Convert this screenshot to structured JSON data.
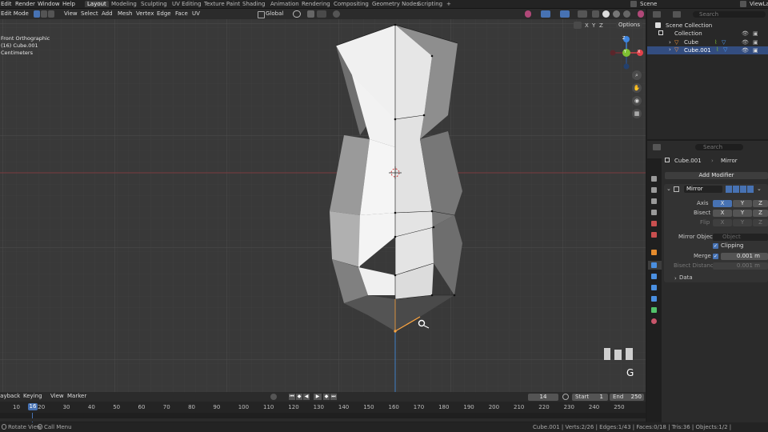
{
  "menus": [
    "Edit",
    "Render",
    "Window",
    "Help"
  ],
  "workspaces": [
    "Layout",
    "Modeling",
    "Sculpting",
    "UV Editing",
    "Texture Paint",
    "Shading",
    "Animation",
    "Rendering",
    "Compositing",
    "Geometry Nodes",
    "Scripting",
    "+"
  ],
  "scene": "Scene",
  "view_layer": "ViewLayer",
  "viewport_header": {
    "mode": "Edit Mode",
    "menus": [
      "View",
      "Select",
      "Add",
      "Mesh",
      "Vertex",
      "Edge",
      "Face",
      "UV"
    ],
    "orientation": "Global",
    "axes": [
      "X",
      "Y",
      "Z"
    ],
    "options": "Options"
  },
  "viewport_overlay": {
    "view_name": "Front Orthographic",
    "object": "(16) Cube.001",
    "units": "Centimeters"
  },
  "gizmo_axes": [
    "Z",
    "X",
    "Y"
  ],
  "key_overlay": "G",
  "outliner": {
    "search_placeholder": "Search",
    "root": "Scene Collection",
    "collection": "Collection",
    "items": [
      "Cube",
      "Cube.001"
    ]
  },
  "properties": {
    "search_placeholder": "Search",
    "object_name": "Cube.001",
    "modifier_crumb": "Mirror",
    "add_modifier": "Add Modifier",
    "modifier_name": "Mirror",
    "axis_label": "Axis",
    "bisect_label": "Bisect",
    "flip_label": "Flip",
    "xyz": [
      "X",
      "Y",
      "Z"
    ],
    "mirror_object_label": "Mirror Object",
    "mirror_object_placeholder": "Object",
    "clipping_label": "Clipping",
    "merge_label": "Merge",
    "merge_value": "0.001 m",
    "bisect_distance_label": "Bisect Distance",
    "bisect_distance_value": "0.001 m",
    "data_panel": "Data",
    "axis_active": [
      true,
      false,
      false
    ],
    "clipping_checked": true,
    "merge_checked": true
  },
  "timeline": {
    "playback": "Playback",
    "keying": "Keying",
    "view": "View",
    "marker": "Marker",
    "current_frame": "14",
    "start_label": "Start",
    "start_value": "1",
    "end_label": "End",
    "end_value": "250",
    "playhead_label": "16",
    "ruler_ticks": [
      "10",
      "20",
      "30",
      "40",
      "50",
      "60",
      "70",
      "80",
      "90",
      "100",
      "110",
      "120",
      "130",
      "140",
      "150",
      "160",
      "170",
      "180",
      "190",
      "200",
      "210",
      "220",
      "230",
      "240",
      "250"
    ]
  },
  "status": {
    "left1": "Rotate View",
    "left2": "Call Menu",
    "stats": "Cube.001 | Verts:2/26 | Edges:1/43 | Faces:0/18 | Tris:36 | Objects:1/2 |"
  },
  "colors": {
    "accent_blue": "#4772b3",
    "active_tab": "#ffa032",
    "selection_orange": "#ffa640",
    "axis_x": "#e0414a",
    "axis_y": "#7fc032",
    "axis_z": "#3f86e0"
  }
}
